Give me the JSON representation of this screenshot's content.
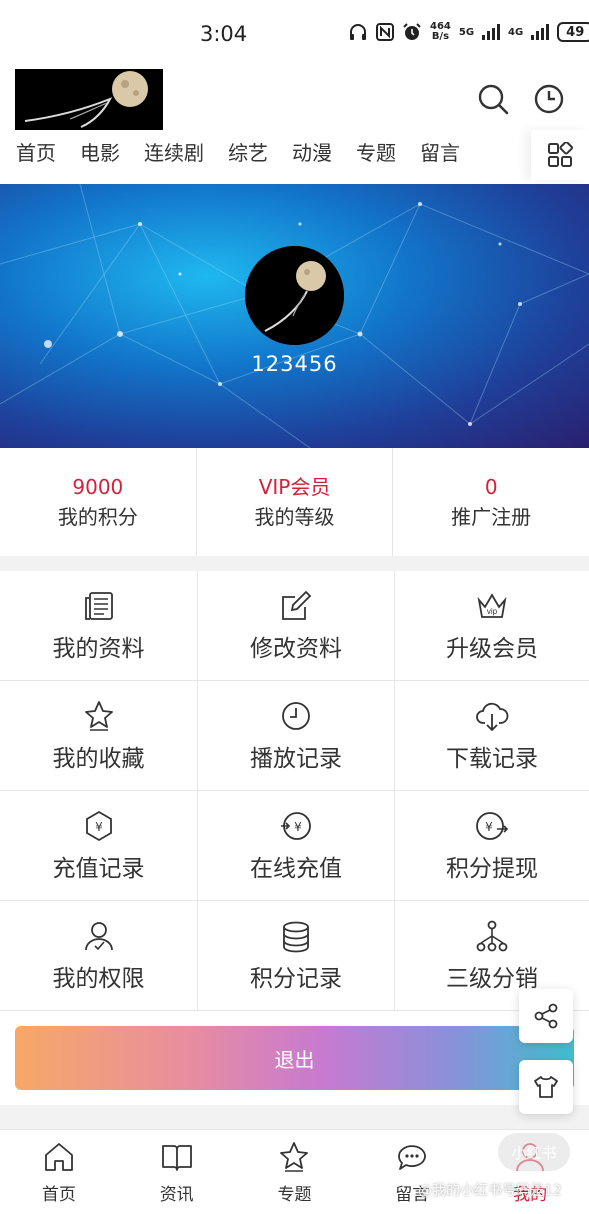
{
  "status_bar": {
    "time": "3:04",
    "net_speed_value": "464",
    "net_speed_unit": "B/s",
    "signal1": "5G",
    "signal2": "4G",
    "battery": "49"
  },
  "header": {
    "nav_items": [
      "首页",
      "电影",
      "连续剧",
      "综艺",
      "动漫",
      "专题",
      "留言"
    ]
  },
  "profile": {
    "username": "123456"
  },
  "stats": [
    {
      "value": "9000",
      "label": "我的积分"
    },
    {
      "value": "VIP会员",
      "label": "我的等级"
    },
    {
      "value": "0",
      "label": "推广注册"
    }
  ],
  "menu": [
    {
      "icon": "profile-doc-icon",
      "label": "我的资料"
    },
    {
      "icon": "edit-icon",
      "label": "修改资料"
    },
    {
      "icon": "vip-crown-icon",
      "label": "升级会员"
    },
    {
      "icon": "star-icon",
      "label": "我的收藏"
    },
    {
      "icon": "clock-icon",
      "label": "播放记录"
    },
    {
      "icon": "cloud-download-icon",
      "label": "下载记录"
    },
    {
      "icon": "yuan-hexagon-icon",
      "label": "充值记录"
    },
    {
      "icon": "yuan-exchange-icon",
      "label": "在线充值"
    },
    {
      "icon": "yuan-withdraw-icon",
      "label": "积分提现"
    },
    {
      "icon": "user-permission-icon",
      "label": "我的权限"
    },
    {
      "icon": "coins-stack-icon",
      "label": "积分记录"
    },
    {
      "icon": "hierarchy-icon",
      "label": "三级分销"
    }
  ],
  "logout_label": "退出",
  "tabbar": [
    {
      "label": "首页",
      "icon": "home-icon",
      "active": false
    },
    {
      "label": "资讯",
      "icon": "book-icon",
      "active": false
    },
    {
      "label": "专题",
      "icon": "star-icon",
      "active": false
    },
    {
      "label": "留言",
      "icon": "chat-icon",
      "active": false
    },
    {
      "label": "我的",
      "icon": "user-icon",
      "active": true
    }
  ],
  "watermark": {
    "text": "@我的小红书号码是12",
    "badge": "小红书"
  },
  "colors": {
    "accent_red": "#d4213b",
    "logout_gradient": [
      "#f7a867",
      "#c77ad0",
      "#3fc0d0"
    ]
  }
}
